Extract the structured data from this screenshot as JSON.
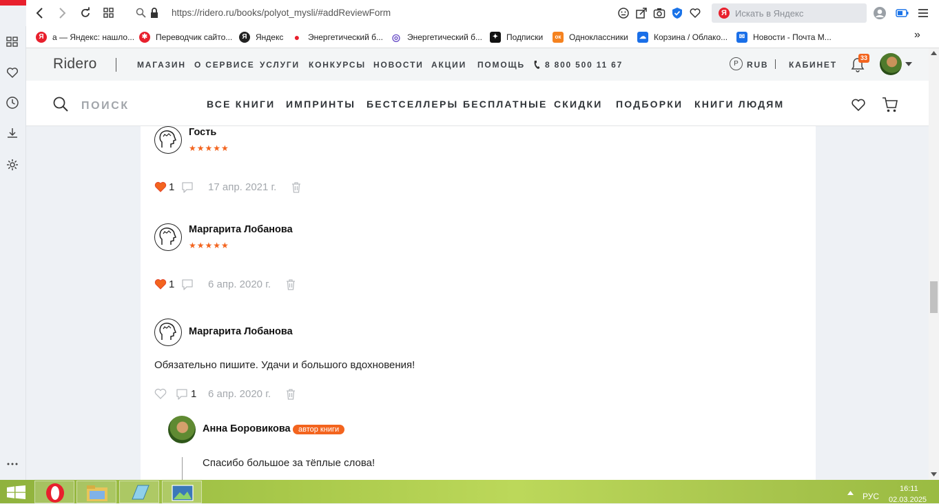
{
  "browser": {
    "url": "https://ridero.ru/books/polyot_mysli/#addReviewForm",
    "search_placeholder": "Искать в Яндекс",
    "bookmarks": [
      {
        "label": "а — Яндекс: нашло...",
        "color": "#e8202d",
        "glyph": "Я"
      },
      {
        "label": "Переводчик сайто...",
        "color": "#e8202d",
        "glyph": "✱"
      },
      {
        "label": "Яндекс",
        "color": "#222222",
        "glyph": "Я"
      },
      {
        "label": "Энергетический б...",
        "color": "#e8202d",
        "glyph": "●"
      },
      {
        "label": "Энергетический б...",
        "color": "#6a4fc7",
        "glyph": "◎"
      },
      {
        "label": "Подписки",
        "color": "#111111",
        "glyph": "✦"
      },
      {
        "label": "Одноклассники",
        "color": "#f5821f",
        "glyph": "ок"
      },
      {
        "label": "Корзина / Облако...",
        "color": "#1a6fe8",
        "glyph": "☁"
      },
      {
        "label": "Новости - Почта М...",
        "color": "#1a6fe8",
        "glyph": "✉"
      }
    ],
    "bookmarks_more": "»"
  },
  "site": {
    "logo": "Ridero",
    "top_nav": [
      "МАГАЗИН",
      "О СЕРВИСЕ",
      "УСЛУГИ",
      "КОНКУРСЫ",
      "НОВОСТИ",
      "АКЦИИ",
      "ПОМОЩЬ"
    ],
    "phone": "8 800 500 11 67",
    "currency_symbol": "Р",
    "currency": "RUB",
    "cabinet": "КАБИНЕТ",
    "notifications": "33",
    "search_label": "ПОИСК",
    "category_nav": [
      "ВСЕ КНИГИ",
      "ИМПРИНТЫ",
      "БЕСТСЕЛЛЕРЫ",
      "БЕСПЛАТНЫЕ",
      "СКИДКИ",
      "ПОДБОРКИ",
      "КНИГИ ЛЮДЯМ"
    ],
    "accent": "#f3641e"
  },
  "reviews": [
    {
      "name": "Гость",
      "stars": "★★★★★",
      "likes": "1",
      "liked": true,
      "date": "17 апр. 2021 г."
    },
    {
      "name": "Маргарита Лобанова",
      "stars": "★★★★★",
      "likes": "1",
      "liked": true,
      "date": "6 апр. 2020 г."
    },
    {
      "name": "Маргарита Лобанова",
      "text": "Обязательно пишите. Удачи и большого вдохновения!",
      "comments": "1",
      "liked": false,
      "date": "6 апр. 2020 г."
    }
  ],
  "reply": {
    "name": "Анна Боровикова",
    "badge": "автор книги",
    "text": "Спасибо большое за тёплые слова!"
  },
  "taskbar": {
    "lang": "РУС",
    "time": "16:11",
    "date": "02.03.2025"
  }
}
